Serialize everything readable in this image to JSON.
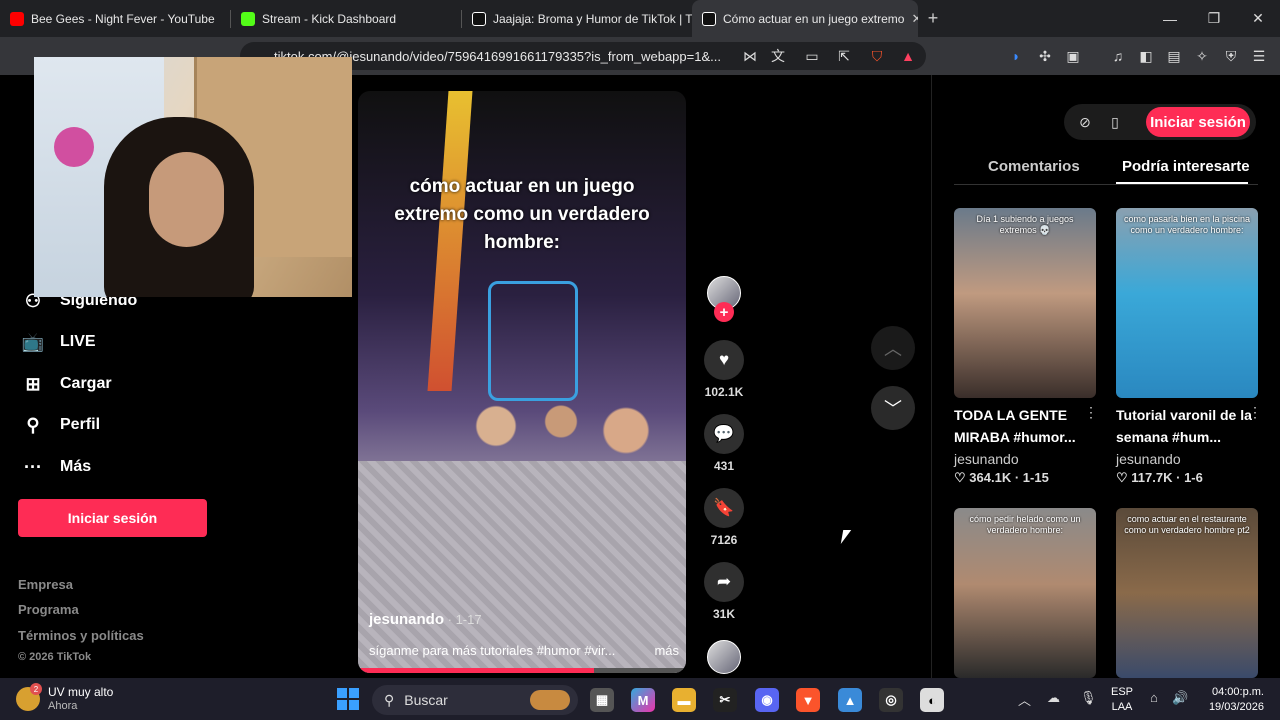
{
  "browser": {
    "tabs": [
      {
        "title": "Bee Gees - Night Fever - YouTube",
        "color": "#ff0000"
      },
      {
        "title": "Stream - Kick Dashboard",
        "color": "#53fc18"
      },
      {
        "title": "Jaajaja: Broma y Humor de TikTok | TikTok",
        "color": "#ffffff"
      },
      {
        "title": "Cómo actuar en un juego extremo",
        "color": "#ffffff"
      }
    ],
    "url": "tiktok.com/@jesunando/video/7596416991661179335?is_from_webapp=1&..."
  },
  "sidebar": {
    "items": [
      {
        "label": "Siguiendo",
        "icon": "following-icon"
      },
      {
        "label": "LIVE",
        "icon": "live-icon"
      },
      {
        "label": "Cargar",
        "icon": "upload-icon"
      },
      {
        "label": "Perfil",
        "icon": "profile-icon"
      },
      {
        "label": "Más",
        "icon": "more-icon"
      }
    ],
    "login_label": "Iniciar sesión",
    "footer": [
      "Empresa",
      "Programa",
      "Términos y políticas",
      "© 2026 TikTok"
    ]
  },
  "video": {
    "overlay_text": "cómo actuar en un juego extremo como un verdadero hombre:",
    "author": "jesunando",
    "date": " · 1-17",
    "caption": "síganme para más tutoriales #humor #vir...",
    "more_label": "más",
    "progress": 0.72
  },
  "actions": {
    "likes": "102.1K",
    "comments": "431",
    "saves": "7126",
    "shares": "31K"
  },
  "right_panel": {
    "login_label": "Iniciar sesión",
    "tabs": [
      "Comentarios",
      "Podría interesarte"
    ],
    "cards": [
      {
        "overlay": "Día 1 subiendo a juegos extremos 💀",
        "title": "TODA LA GENTE MIRABA #humor...",
        "user": "jesunando",
        "likes": "364.1K",
        "date": "1-15"
      },
      {
        "overlay": "como pasarla bien en la piscina como un verdadero hombre:",
        "title": "Tutorial varonil de la semana #hum...",
        "user": "jesunando",
        "likes": "117.7K",
        "date": "1-6"
      },
      {
        "overlay": "cómo pedir helado como un verdadero hombre:",
        "title": "",
        "user": "",
        "likes": "",
        "date": ""
      },
      {
        "overlay": "como actuar en el restaurante como un verdadero hombre pt2",
        "title": "",
        "user": "",
        "likes": "",
        "date": ""
      }
    ]
  },
  "taskbar": {
    "weather_title": "UV muy alto",
    "weather_sub": "Ahora",
    "weather_badge": "2",
    "search_placeholder": "Buscar",
    "lang_1": "ESP",
    "lang_2": "LAA",
    "time": "04:00:p.m.",
    "date": "19/03/2026"
  }
}
